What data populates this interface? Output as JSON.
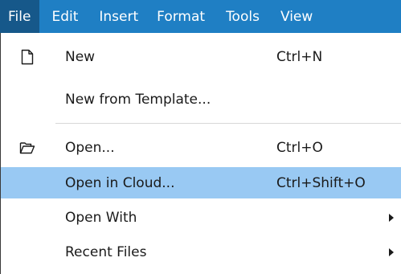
{
  "menubar": {
    "items": [
      {
        "label": "File"
      },
      {
        "label": "Edit"
      },
      {
        "label": "Insert"
      },
      {
        "label": "Format"
      },
      {
        "label": "Tools"
      },
      {
        "label": "View"
      }
    ]
  },
  "file_menu": {
    "items": [
      {
        "label": "New",
        "shortcut": "Ctrl+N",
        "icon": "new-document-icon"
      },
      {
        "label": "New from Template...",
        "shortcut": ""
      },
      {
        "label": "Open...",
        "shortcut": "Ctrl+O",
        "icon": "open-folder-icon"
      },
      {
        "label": "Open in Cloud...",
        "shortcut": "Ctrl+Shift+O",
        "highlighted": true
      },
      {
        "label": "Open With",
        "shortcut": "",
        "submenu": true
      },
      {
        "label": "Recent Files",
        "shortcut": "",
        "submenu": true
      }
    ]
  },
  "colors": {
    "menubar_bg": "#1f7fc4",
    "menubar_active": "#16588a",
    "highlight": "#99c9f3"
  }
}
